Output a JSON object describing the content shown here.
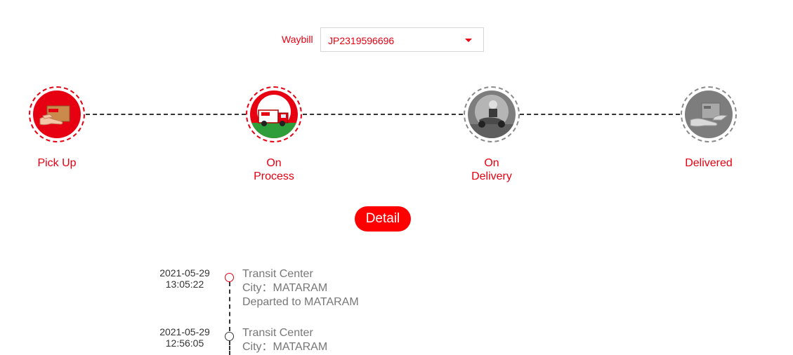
{
  "waybill": {
    "label": "Waybill",
    "selected": "JP2319596696",
    "caret_icon": "caret-down-icon"
  },
  "steps": [
    {
      "line1": "Pick Up",
      "line2": "",
      "state": "active",
      "icon": "package-hand-icon"
    },
    {
      "line1": "On",
      "line2": "Process",
      "state": "active",
      "icon": "delivery-truck-icon"
    },
    {
      "line1": "On",
      "line2": "Delivery",
      "state": "inactive",
      "icon": "courier-motorbike-icon"
    },
    {
      "line1": "Delivered",
      "line2": "",
      "state": "inactive",
      "icon": "handover-package-icon"
    }
  ],
  "detail_button": "Detail",
  "timeline": [
    {
      "date": "2021-05-29",
      "time": "13:05:22",
      "lines": [
        "Transit Center",
        "City：MATARAM",
        "Departed to MATARAM"
      ],
      "marker": "red"
    },
    {
      "date": "2021-05-29",
      "time": "12:56:05",
      "lines": [
        "Transit Center",
        "City：MATARAM"
      ],
      "marker": "dark"
    }
  ],
  "colors": {
    "accent": "#e60012",
    "button": "#ff0000",
    "inactive": "#7d7d7d",
    "text_muted": "#777777"
  }
}
